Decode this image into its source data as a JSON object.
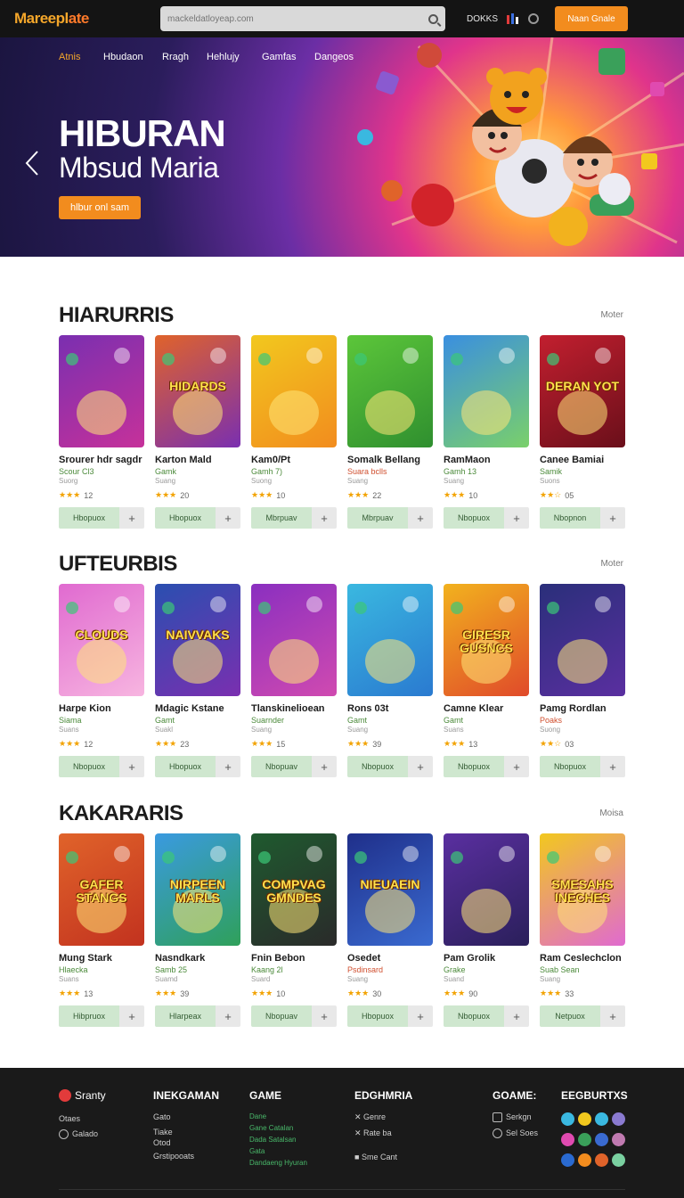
{
  "header": {
    "logo_a": "Mareepl",
    "logo_b": "ate",
    "search_placeholder": "mackeldatloyeap.com",
    "link": "DOKKS",
    "cta": "Naan Gnale"
  },
  "hero": {
    "nav": [
      "Atnis",
      "Hbudaon",
      "Rragh",
      "Hehlujy",
      "Gamfas",
      "Dangeos"
    ],
    "title": "HIBURAN",
    "subtitle": "Mbsud Maria",
    "button": "hlbur onl sam"
  },
  "sections": [
    {
      "title": "HIARURRIS",
      "more": "Moter",
      "items": [
        {
          "name": "Srourer hdr sagdr",
          "category": "Scour Cl3",
          "sub": "Suorg",
          "rating": "12",
          "stars": "★★★",
          "add": "Hbopuox",
          "thumb_text": "",
          "c1": "#7a2fb0",
          "c2": "#c6319a"
        },
        {
          "name": "Karton Mald",
          "category": "Gamk",
          "sub": "Suang",
          "rating": "20",
          "stars": "★★★",
          "add": "Hbopuox",
          "thumb_text": "HIDARDS",
          "c1": "#e0632a",
          "c2": "#7a2fb0"
        },
        {
          "name": "Kam0/Pt",
          "category": "Gamh 7)",
          "sub": "Suong",
          "rating": "10",
          "stars": "★★★",
          "add": "Mbrpuav",
          "thumb_text": "",
          "c1": "#f2c81e",
          "c2": "#f28c1e"
        },
        {
          "name": "Somalk Bellang",
          "category": "Suara bclls",
          "sub": "Suang",
          "rating": "22",
          "stars": "★★★",
          "add": "Mbrpuav",
          "thumb_text": "",
          "c1": "#5cc63a",
          "c2": "#2f8f2f"
        },
        {
          "name": "RamMaon",
          "category": "Gamh 13",
          "sub": "Suang",
          "rating": "10",
          "stars": "★★★",
          "add": "Nbopuox",
          "thumb_text": "",
          "c1": "#3a8fe0",
          "c2": "#7ad06a"
        },
        {
          "name": "Canee Bamiai",
          "category": "Samik",
          "sub": "Suons",
          "rating": "05",
          "stars": "★★☆",
          "add": "Nbopnon",
          "thumb_text": "DERAN YOT",
          "c1": "#c21f2f",
          "c2": "#6a0f1a"
        }
      ]
    },
    {
      "title": "UFTEURBIS",
      "more": "Moter",
      "items": [
        {
          "name": "Harpe Kion",
          "category": "Siama",
          "sub": "Suans",
          "rating": "12",
          "stars": "★★★",
          "add": "Nbopuox",
          "thumb_text": "CLOUDS",
          "c1": "#e06ad0",
          "c2": "#f7b5e0"
        },
        {
          "name": "Mdagic Kstane",
          "category": "Gamt",
          "sub": "Suakl",
          "rating": "23",
          "stars": "★★★",
          "add": "Hbopuox",
          "thumb_text": "NAIVVAKS",
          "c1": "#2a4fb0",
          "c2": "#7a2fb0"
        },
        {
          "name": "Tlanskinelioean",
          "category": "Suarnder",
          "sub": "Suang",
          "rating": "15",
          "stars": "★★★",
          "add": "Nbopuav",
          "thumb_text": "",
          "c1": "#8a2fc0",
          "c2": "#d04ab0"
        },
        {
          "name": "Rons 03t",
          "category": "Gamt",
          "sub": "Suang",
          "rating": "39",
          "stars": "★★★",
          "add": "Nbopuox",
          "thumb_text": "",
          "c1": "#3ab8e0",
          "c2": "#2a7ad0"
        },
        {
          "name": "Camne Klear",
          "category": "Gamt",
          "sub": "Suans",
          "rating": "13",
          "stars": "★★★",
          "add": "Nbopuox",
          "thumb_text": "GIRESR GUSNCS",
          "c1": "#f2b21e",
          "c2": "#e04a2a"
        },
        {
          "name": "Pamg Rordlan",
          "category": "Poaks",
          "sub": "Suong",
          "rating": "03",
          "stars": "★★☆",
          "add": "Nbopuox",
          "thumb_text": "",
          "c1": "#2a2f7a",
          "c2": "#5a2fa0"
        }
      ]
    },
    {
      "title": "KAKARARIS",
      "more": "Moisa",
      "items": [
        {
          "name": "Mung Stark",
          "category": "Hlaecka",
          "sub": "Suans",
          "rating": "13",
          "stars": "★★★",
          "add": "Hibpruox",
          "thumb_text": "GAFER STANGS",
          "c1": "#e0632a",
          "c2": "#c2321f"
        },
        {
          "name": "Nasndkark",
          "category": "Samb 25",
          "sub": "Suamd",
          "rating": "39",
          "stars": "★★★",
          "add": "Hlarpeax",
          "thumb_text": "NIRPEEN MARLS",
          "c1": "#3a9ae0",
          "c2": "#2fa05a"
        },
        {
          "name": "Fnin Bebon",
          "category": "Kaang 2l",
          "sub": "Suard",
          "rating": "10",
          "stars": "★★★",
          "add": "Nbopuav",
          "thumb_text": "COMPVAG GMNDES",
          "c1": "#1f5a2f",
          "c2": "#2a2a2a"
        },
        {
          "name": "Osedet",
          "category": "Psdinsard",
          "sub": "Suang",
          "rating": "30",
          "stars": "★★★",
          "add": "Hbopuox",
          "thumb_text": "NIEUAEIN",
          "c1": "#1f2f8a",
          "c2": "#3a6ad0"
        },
        {
          "name": "Pam Grolik",
          "category": "Grake",
          "sub": "Suand",
          "rating": "90",
          "stars": "★★★",
          "add": "Nbopuox",
          "thumb_text": "",
          "c1": "#5a2fa0",
          "c2": "#2a1f5a"
        },
        {
          "name": "Ram Ceslechclon",
          "category": "Suab Sean",
          "sub": "Suang",
          "rating": "33",
          "stars": "★★★",
          "add": "Netpuox",
          "thumb_text": "SMESAHS INECHES",
          "c1": "#f2c81e",
          "c2": "#e06ad0"
        }
      ]
    }
  ],
  "footer": {
    "brand": "Sranty",
    "col1": [
      "Otaes",
      "Galado"
    ],
    "col2_title": "INEKGAMAN",
    "col2": [
      "Gato",
      "Tiake",
      "Otod",
      "Grstipooats"
    ],
    "col3_title": "GAME",
    "col3": [
      "Dane",
      "Gane Catalan",
      "Dada Satalsan",
      "Gata",
      "Dandaeng Hyuran"
    ],
    "col4_title": "EDGHMRIA",
    "col4": [
      "Genre",
      "Rate ba",
      "Sme Cant"
    ],
    "col5_title": "GOAME:",
    "col5": [
      "Serkgn",
      "Sel Soes"
    ],
    "col6_title": "EEGBURTXS",
    "dot_colors": [
      "#3ab8e0",
      "#f2c81e",
      "#3ab8e0",
      "#8a7ad0",
      "#e04ab0",
      "#3aa05a",
      "#3a6ad0",
      "#c07ab0",
      "#2a6ad0",
      "#f28c1e",
      "#e0632a",
      "#7ad0a0"
    ]
  }
}
